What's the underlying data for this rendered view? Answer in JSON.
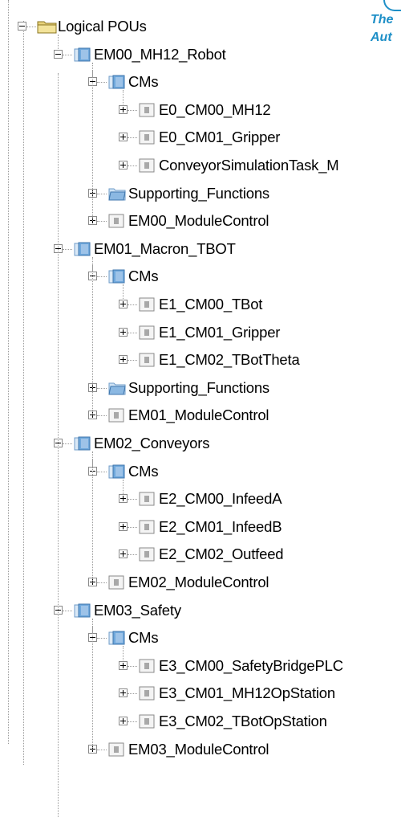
{
  "tree": {
    "root": {
      "label": "Logical POUs",
      "icon": "folder-icon",
      "expanded": true
    },
    "items": [
      {
        "label": "EM00_MH12_Robot",
        "icon": "module-folder-icon",
        "level": 1,
        "toggle": "minus"
      },
      {
        "label": "CMs",
        "icon": "module-folder-icon",
        "level": 2,
        "toggle": "minus"
      },
      {
        "label": "E0_CM00_MH12",
        "icon": "pou-icon",
        "level": 3,
        "toggle": "plus"
      },
      {
        "label": "E0_CM01_Gripper",
        "icon": "pou-icon",
        "level": 3,
        "toggle": "plus"
      },
      {
        "label": "ConveyorSimulationTask_M",
        "icon": "pou-icon",
        "level": 3,
        "toggle": "plus"
      },
      {
        "label": "Supporting_Functions",
        "icon": "function-folder-icon",
        "level": 2,
        "toggle": "plus"
      },
      {
        "label": "EM00_ModuleControl",
        "icon": "pou-icon",
        "level": 2,
        "toggle": "plus"
      },
      {
        "label": "EM01_Macron_TBOT",
        "icon": "module-folder-icon",
        "level": 1,
        "toggle": "minus"
      },
      {
        "label": "CMs",
        "icon": "module-folder-icon",
        "level": 2,
        "toggle": "minus"
      },
      {
        "label": "E1_CM00_TBot",
        "icon": "pou-icon",
        "level": 3,
        "toggle": "plus"
      },
      {
        "label": "E1_CM01_Gripper",
        "icon": "pou-icon",
        "level": 3,
        "toggle": "plus"
      },
      {
        "label": "E1_CM02_TBotTheta",
        "icon": "pou-icon",
        "level": 3,
        "toggle": "plus"
      },
      {
        "label": "Supporting_Functions",
        "icon": "function-folder-icon",
        "level": 2,
        "toggle": "plus"
      },
      {
        "label": "EM01_ModuleControl",
        "icon": "pou-icon",
        "level": 2,
        "toggle": "plus"
      },
      {
        "label": "EM02_Conveyors",
        "icon": "module-folder-icon",
        "level": 1,
        "toggle": "minus"
      },
      {
        "label": "CMs",
        "icon": "module-folder-icon",
        "level": 2,
        "toggle": "minus"
      },
      {
        "label": "E2_CM00_InfeedA",
        "icon": "pou-icon",
        "level": 3,
        "toggle": "plus"
      },
      {
        "label": "E2_CM01_InfeedB",
        "icon": "pou-icon",
        "level": 3,
        "toggle": "plus"
      },
      {
        "label": "E2_CM02_Outfeed",
        "icon": "pou-icon",
        "level": 3,
        "toggle": "plus"
      },
      {
        "label": "EM02_ModuleControl",
        "icon": "pou-icon",
        "level": 2,
        "toggle": "plus"
      },
      {
        "label": "EM03_Safety",
        "icon": "module-folder-icon",
        "level": 1,
        "toggle": "minus"
      },
      {
        "label": "CMs",
        "icon": "module-folder-icon",
        "level": 2,
        "toggle": "minus"
      },
      {
        "label": "E3_CM00_SafetyBridgePLC",
        "icon": "pou-icon",
        "level": 3,
        "toggle": "plus"
      },
      {
        "label": "E3_CM01_MH12OpStation",
        "icon": "pou-icon",
        "level": 3,
        "toggle": "plus"
      },
      {
        "label": "E3_CM02_TBotOpStation",
        "icon": "pou-icon",
        "level": 3,
        "toggle": "plus"
      },
      {
        "label": "EM03_ModuleControl",
        "icon": "pou-icon",
        "level": 2,
        "toggle": "plus"
      }
    ]
  },
  "brand_fragment": {
    "line1": "The",
    "line2": "Aut"
  },
  "colors": {
    "folder_blue": "#6fa8dc",
    "brand": "#1e8fc7",
    "tree_line": "#9a9a9a"
  }
}
